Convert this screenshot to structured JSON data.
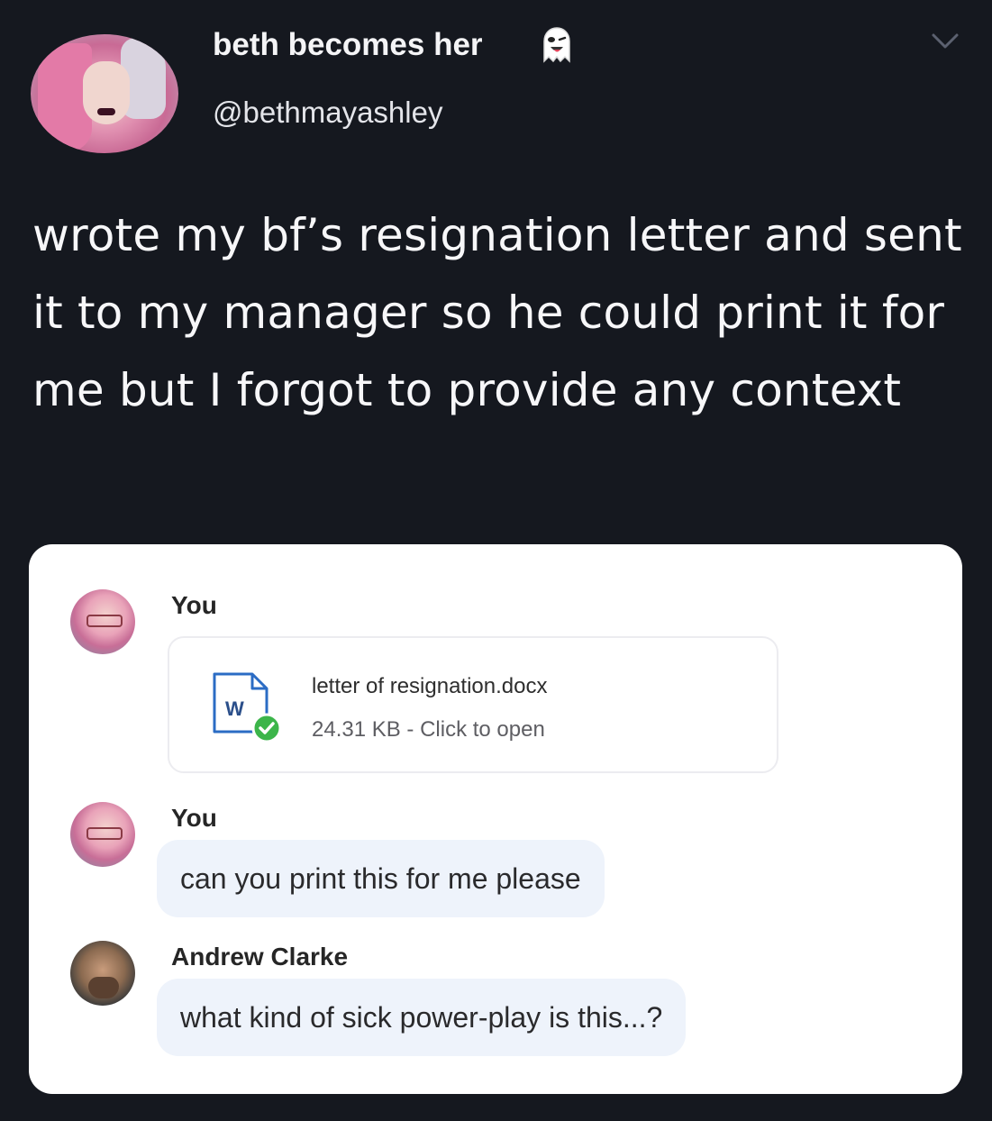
{
  "tweet": {
    "display_name": "beth becomes her",
    "handle": "@bethmayashley",
    "name_emoji_icon": "ghost-emoji-icon",
    "menu_icon": "chevron-down-icon",
    "text": "wrote my bf’s resignation letter and sent it to my manager so he could print it for me but I forgot to provide any context"
  },
  "chat": {
    "messages": [
      {
        "sender": "You",
        "attachment": {
          "icon": "word-document-icon",
          "file_name": "letter of resignation.docx",
          "meta": "24.31 KB - Click to open"
        }
      },
      {
        "sender": "You",
        "text": "can you print this for me please"
      },
      {
        "sender": "Andrew Clarke",
        "text": "what kind of sick power-play is this...?"
      }
    ]
  },
  "colors": {
    "page_bg": "#15181f",
    "card_bg": "#ffffff",
    "bubble_bg": "#eef3fb",
    "word_blue": "#2b6cc4",
    "check_green": "#3cb54a"
  }
}
